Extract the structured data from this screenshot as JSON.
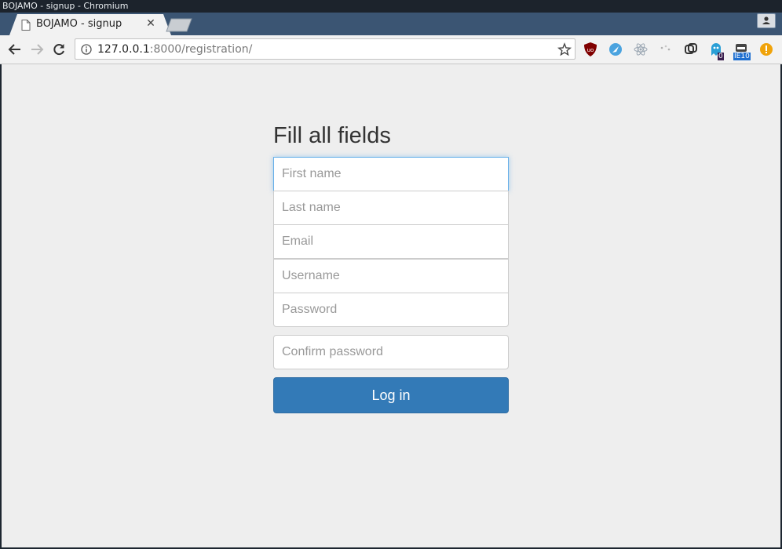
{
  "window": {
    "title": "BOJAMO - signup - Chromium"
  },
  "tab": {
    "title": "BOJAMO - signup",
    "close_glyph": "✕",
    "icon": "page-icon"
  },
  "toolbar": {
    "url_host": "127.0.0.1",
    "url_rest": ":8000/registration/",
    "extensions": [
      {
        "name": "ublock-origin-icon",
        "color": "#800000"
      },
      {
        "name": "blue-bird-icon",
        "color": "#4aa3df"
      },
      {
        "name": "react-devtools-icon",
        "color": "#9aa6b2"
      },
      {
        "name": "dots-icon",
        "color": "#b0b0b0"
      },
      {
        "name": "link-icon",
        "color": "#333333"
      },
      {
        "name": "ghostery-icon",
        "color": "#2a9fd6",
        "badge": "0"
      },
      {
        "name": "ie-tab-icon",
        "color": "#1e6fd0",
        "badge": "IE10"
      },
      {
        "name": "alert-icon",
        "color": "#f0a30a"
      }
    ]
  },
  "form": {
    "title": "Fill all fields",
    "fields": [
      {
        "placeholder": "First name"
      },
      {
        "placeholder": "Last name"
      },
      {
        "placeholder": "Email"
      },
      {
        "placeholder": "Username"
      },
      {
        "placeholder": "Password"
      },
      {
        "placeholder": "Confirm password"
      }
    ],
    "submit_label": "Log in"
  },
  "colors": {
    "primary": "#337ab7",
    "page_bg": "#eeeeee",
    "tabstrip": "#3b5573",
    "focus": "#66afe9"
  }
}
